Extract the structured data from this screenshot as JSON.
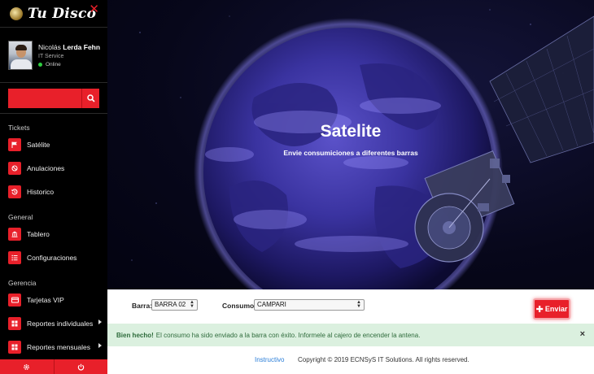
{
  "brand": {
    "name": "Tu Disco",
    "close_glyph": "✕"
  },
  "user": {
    "first_name": "Nicolás",
    "last_name": "Lerda Fehn",
    "role": "IT Service",
    "status": "Online"
  },
  "search": {
    "value": "",
    "placeholder": ""
  },
  "sections": {
    "tickets": {
      "title": "Tickets",
      "items": [
        {
          "label": "Satélite",
          "icon": "flag-icon"
        },
        {
          "label": "Anulaciones",
          "icon": "ban-icon"
        },
        {
          "label": "Historico",
          "icon": "history-icon"
        }
      ]
    },
    "general": {
      "title": "General",
      "items": [
        {
          "label": "Tablero",
          "icon": "bank-icon"
        },
        {
          "label": "Configuraciones",
          "icon": "list-icon"
        }
      ]
    },
    "gerencia": {
      "title": "Gerencia",
      "items": [
        {
          "label": "Tarjetas VIP",
          "icon": "card-icon"
        },
        {
          "label": "Reportes individuales",
          "icon": "grid-icon"
        },
        {
          "label": "Reportes mensuales",
          "icon": "grid-icon"
        }
      ]
    }
  },
  "hero": {
    "title": "Satelite",
    "subtitle": "Envie consumiciones a diferentes barras"
  },
  "form": {
    "barra_label": "Barra:",
    "barra_value": "BARRA 02",
    "consumo_label": "Consumo:",
    "consumo_value": "CAMPARI",
    "send_label": "Enviar",
    "send_icon": "plus-icon"
  },
  "alert": {
    "strong": "Bien hecho!",
    "message": "El consumo ha sido enviado a la barra con éxito. Informele al cajero de encender la antena.",
    "close_glyph": "×"
  },
  "footer": {
    "link": "Instructivo",
    "copyright": "Copyright © 2019 ECNSyS IT Solutions. All rights reserved."
  },
  "colors": {
    "accent": "#e8202a",
    "sidebar_bg": "#000000",
    "alert_bg": "#dbf0df",
    "alert_text": "#2e6b3b",
    "link": "#2a7ed8"
  }
}
